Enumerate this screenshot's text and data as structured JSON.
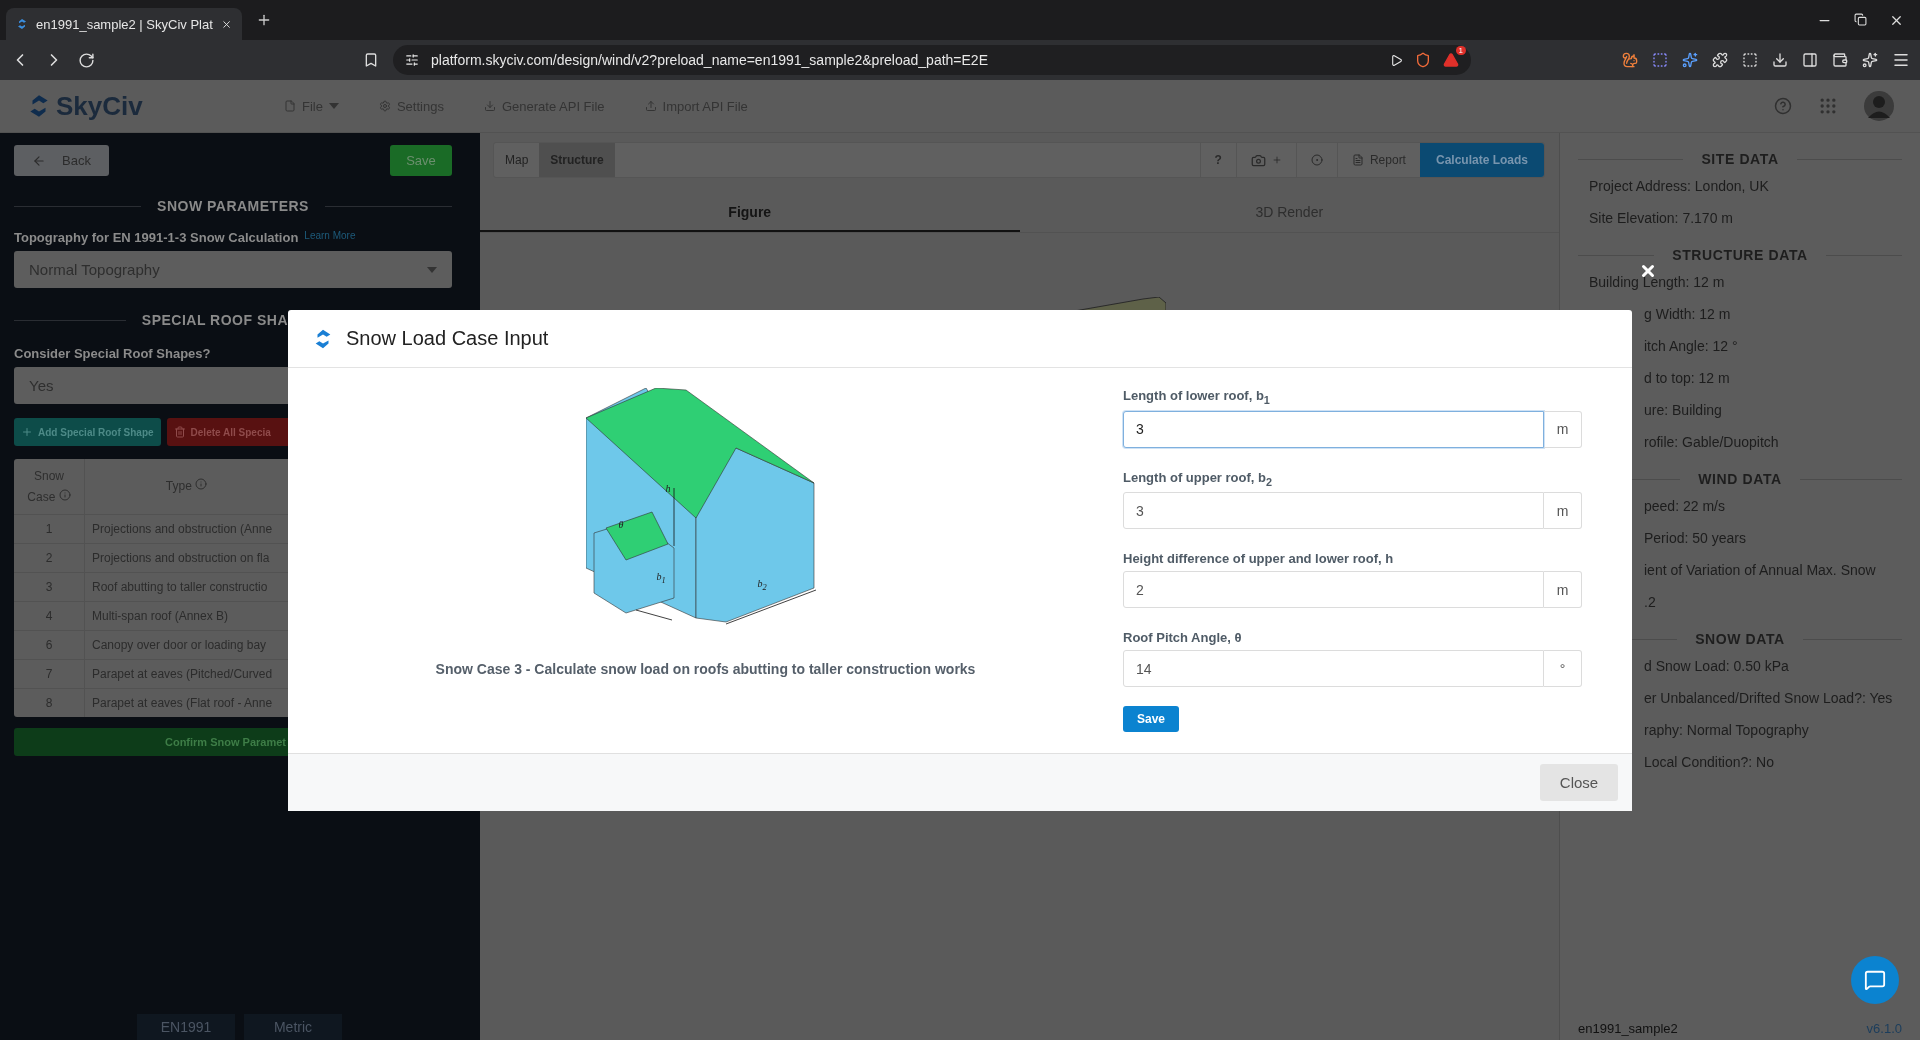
{
  "browser": {
    "tab_title": "en1991_sample2 | SkyCiv Plat",
    "url": "platform.skyciv.com/design/wind/v2?preload_name=en1991_sample2&preload_path=E2E",
    "alert_badge": "1"
  },
  "app_header": {
    "logo": "SkyCiv",
    "menu": [
      {
        "label": "File",
        "has_caret": true
      },
      {
        "label": "Settings",
        "has_caret": false
      },
      {
        "label": "Generate API File",
        "has_caret": false
      },
      {
        "label": "Import API File",
        "has_caret": false
      }
    ]
  },
  "left_panel": {
    "back_button": "Back",
    "save_button": "Save",
    "snow_parameters": {
      "heading": "SNOW PARAMETERS",
      "covered": false,
      "label": "Topography for EN 1991-1-3 Snow Calculation",
      "link": "Learn More",
      "value": "Normal Topography"
    },
    "special_roof": {
      "heading": "SPECIAL ROOF SHA",
      "covered": true,
      "question": "Consider Special Roof Shapes?",
      "value": "Yes",
      "add_button": "Add Special Roof Shape",
      "delete_button": "Delete All Specia",
      "table": {
        "columns": [
          "Snow Case",
          "Type"
        ],
        "rows": [
          [
            "1",
            "Projections and obstruction (Anne"
          ],
          [
            "2",
            "Projections and obstruction on fla"
          ],
          [
            "3",
            "Roof abutting to taller constructio"
          ],
          [
            "4",
            "Multi-span roof (Annex B)"
          ],
          [
            "6",
            "Canopy over door or loading bay"
          ],
          [
            "7",
            "Parapet at eaves (Pitched/Curved"
          ],
          [
            "8",
            "Parapet at eaves (Flat roof - Anne"
          ]
        ]
      },
      "confirm_button": "Confirm Snow Paramet"
    },
    "footer_tabs": [
      "EN1991",
      "Metric"
    ]
  },
  "toolbar": {
    "view_tabs": [
      {
        "label": "Map",
        "selected": false
      },
      {
        "label": "Structure",
        "selected": true
      }
    ],
    "help": "?",
    "report": "Report",
    "calculate": "Calculate Loads"
  },
  "figure_tabs": [
    {
      "label": "Figure",
      "selected": true
    },
    {
      "label": "3D Render",
      "selected": false
    }
  ],
  "right_panel": {
    "sections": [
      {
        "heading": "SITE DATA",
        "rows": [
          {
            "text": "Project Address: London, UK",
            "covered": false
          },
          {
            "text": "Site Elevation: 7.170 m",
            "covered": false
          }
        ]
      },
      {
        "heading": "STRUCTURE DATA",
        "rows": [
          {
            "text": "Building Length: 12 m",
            "covered": false
          },
          {
            "text": "g Width: 12 m",
            "covered": true
          },
          {
            "text": "itch Angle: 12 °",
            "covered": true
          },
          {
            "text": "d to top: 12 m",
            "covered": true
          },
          {
            "text": "ure: Building",
            "covered": true
          },
          {
            "text": "rofile: Gable/Duopitch",
            "covered": true
          }
        ]
      },
      {
        "heading": "WIND DATA",
        "rows": [
          {
            "text": "peed: 22 m/s",
            "covered": true
          },
          {
            "text": "Period: 50 years",
            "covered": true
          },
          {
            "text": "ient of Variation of Annual Max. Snow",
            "covered": true
          },
          {
            "text": ".2",
            "covered": true
          }
        ]
      },
      {
        "heading": "SNOW DATA",
        "rows": [
          {
            "text": "d Snow Load: 0.50 kPa",
            "covered": true
          },
          {
            "text": "er Unbalanced/Drifted Snow Load?: Yes",
            "covered": true
          },
          {
            "text": "raphy: Normal Topography",
            "covered": true
          },
          {
            "text": "Local Condition?: No",
            "covered": true
          }
        ]
      }
    ],
    "project_name": "en1991_sample2",
    "version": "v6.1.0"
  },
  "modal": {
    "title": "Snow Load Case Input",
    "figure_labels": [
      "h",
      "θ",
      "b$_{1}$",
      "b$_{2}$"
    ],
    "caption": "Snow Case 3 - Calculate snow load on roofs abutting to taller construction works",
    "fields": [
      {
        "label": "Length of lower roof, b$_{1}$",
        "value": "3",
        "unit": "m",
        "focused": true
      },
      {
        "label": "Length of upper roof, b$_{2}$",
        "value": "3",
        "unit": "m",
        "focused": false
      },
      {
        "label": "Height difference of upper and lower roof, h",
        "value": "2",
        "unit": "m",
        "focused": false
      },
      {
        "label": "Roof Pitch Angle, θ",
        "value": "14",
        "unit": "°",
        "focused": false
      }
    ],
    "save_button": "Save",
    "close_button": "Close"
  }
}
